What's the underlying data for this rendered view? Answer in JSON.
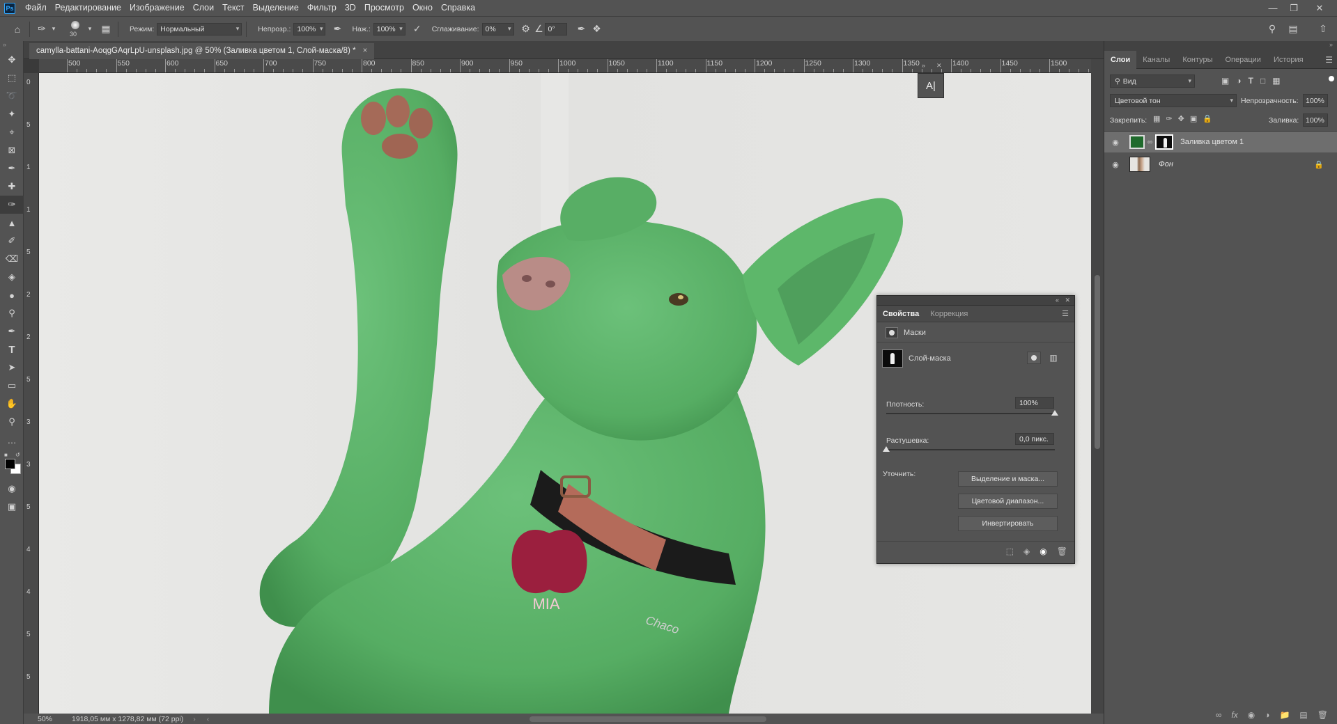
{
  "menu": {
    "items": [
      "Файл",
      "Редактирование",
      "Изображение",
      "Слои",
      "Текст",
      "Выделение",
      "Фильтр",
      "3D",
      "Просмотр",
      "Окно",
      "Справка"
    ]
  },
  "options": {
    "brush_size": "30",
    "mode_label": "Режим:",
    "mode_value": "Нормальный",
    "opacity_label": "Непрозр.:",
    "opacity_value": "100%",
    "pressure_label": "Наж.:",
    "pressure_value": "100%",
    "smoothing_label": "Сглаживание:",
    "smoothing_value": "0%",
    "angle_value": "0°"
  },
  "document": {
    "tab_title": "camylla-battani-AoqgGAqrLpU-unsplash.jpg @ 50% (Заливка цветом 1, Слой-маска/8) *",
    "close_glyph": "×"
  },
  "ruler": {
    "top_ticks": [
      "500",
      "550",
      "600",
      "650",
      "700",
      "750",
      "800",
      "850",
      "900",
      "950",
      "1000",
      "1050",
      "1100",
      "1150",
      "1200",
      "1250",
      "1300",
      "1350",
      "1400",
      "1450",
      "1500"
    ],
    "left_ticks": [
      "0",
      "5",
      "1",
      "1",
      "5",
      "2",
      "2",
      "5",
      "3",
      "3",
      "5",
      "4",
      "4",
      "5",
      "5"
    ]
  },
  "image": {
    "collar_tag_text": "MIA",
    "collar_brand_text": "Chaco",
    "dog_color": "#5fb66d",
    "background_color": "#e5e5e3"
  },
  "status": {
    "zoom": "50%",
    "dimensions": "1918,05 мм x 1278,82 мм (72 ppi)"
  },
  "layers_panel": {
    "tabs": [
      "Слои",
      "Каналы",
      "Контуры",
      "Операции",
      "История"
    ],
    "active_tab": "Слои",
    "filter_label": "Вид",
    "blend_mode": "Цветовой тон",
    "opacity_label": "Непрозрачность:",
    "opacity_value": "100%",
    "lock_label": "Закрепить:",
    "fill_label": "Заливка:",
    "fill_value": "100%",
    "layers": [
      {
        "name": "Заливка цветом 1",
        "swatch": "#1f6a2c"
      },
      {
        "name": "Фон"
      }
    ]
  },
  "properties_panel": {
    "tabs": [
      "Свойства",
      "Коррекция"
    ],
    "masks_label": "Маски",
    "layer_mask_label": "Слой-маска",
    "density_label": "Плотность:",
    "density_value": "100%",
    "density": 1.0,
    "feather_label": "Растушевка:",
    "feather_value": "0,0 пикс.",
    "feather": 0.0,
    "refine_label": "Уточнить:",
    "buttons": [
      "Выделение и маска...",
      "Цветовой диапазон...",
      "Инвертировать"
    ]
  },
  "glyph_panel": {
    "label": "A|"
  },
  "colors": {
    "ui_bg": "#535353",
    "accent": "#31a8ff"
  }
}
